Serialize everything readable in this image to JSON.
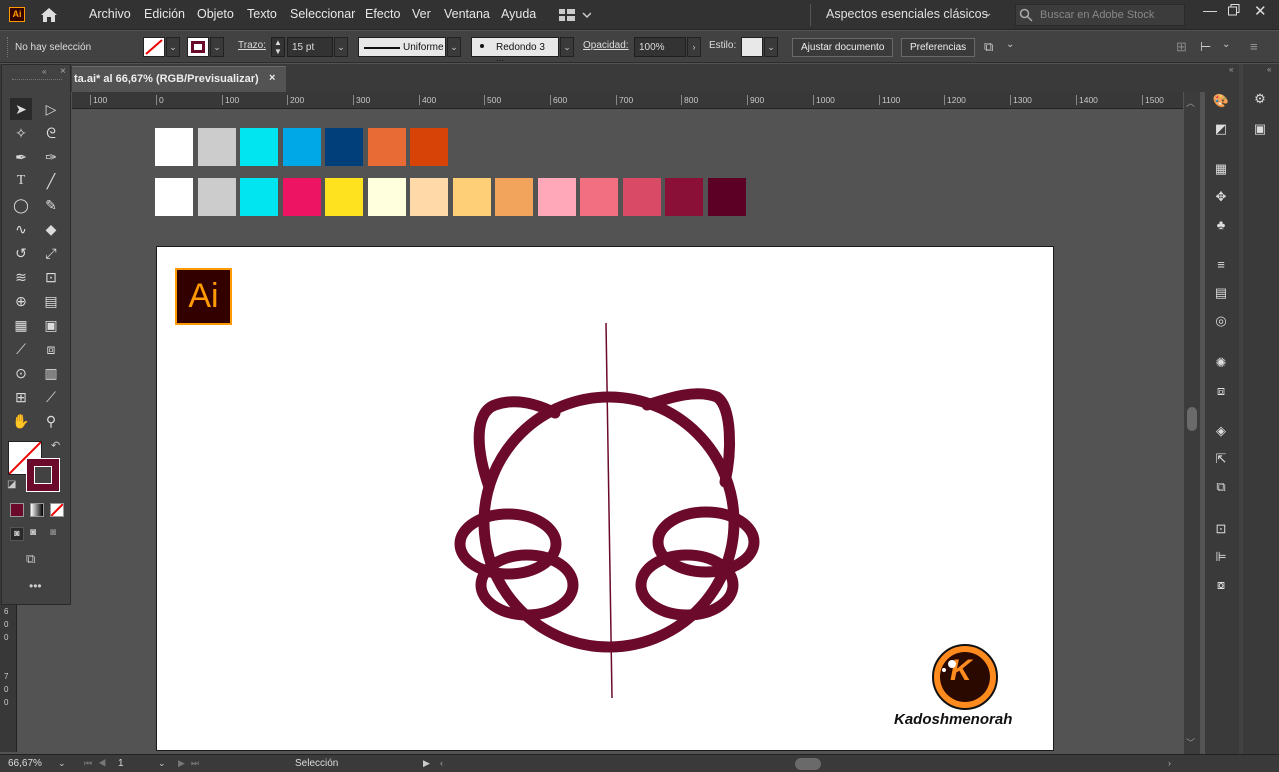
{
  "menubar": {
    "app_logo": "Ai",
    "items": [
      "Archivo",
      "Edición",
      "Objeto",
      "Texto",
      "Seleccionar",
      "Efecto",
      "Ver",
      "Ventana",
      "Ayuda"
    ],
    "workspace": "Aspectos esenciales clásicos",
    "stock_placeholder": "Buscar en Adobe Stock"
  },
  "control": {
    "selection": "No hay selección",
    "stroke_label": "Trazo:",
    "stroke_weight": "15 pt",
    "profile": "Uniforme",
    "brush": "Redondo 3 ...",
    "opacity_label": "Opacidad:",
    "opacity": "100%",
    "style_label": "Estilo:",
    "adjust_btn": "Ajustar documento",
    "prefs_btn": "Preferencias"
  },
  "document": {
    "tab_title": "ta.ai* al 66,67% (RGB/Previsualizar)",
    "close": "×"
  },
  "ruler": {
    "h_ticks": [
      "100",
      "0",
      "100",
      "200",
      "300",
      "400",
      "500",
      "600",
      "700",
      "800",
      "900",
      "1000",
      "1100",
      "1200",
      "1300",
      "1400",
      "1500"
    ],
    "v_ticks": [
      "6",
      "0",
      "0",
      "7",
      "0",
      "0"
    ]
  },
  "swatches": {
    "row1": [
      "#ffffff",
      "#cccccc",
      "#00e5f0",
      "#00a8e8",
      "#003f7a",
      "#e86a35",
      "#d74307"
    ],
    "row2": [
      "#ffffff",
      "#cccccc",
      "#00e5f0",
      "#ee1464",
      "#ffe21f",
      "#ffffdd",
      "#ffd9a8",
      "#ffcf78",
      "#f2a45c",
      "#ffa8b9",
      "#f26f82",
      "#d94a66",
      "#8a1038",
      "#5c0026"
    ]
  },
  "artwork": {
    "stroke_color": "#6b0a2b",
    "logo_text": "Ai",
    "brand_initial": "K",
    "brand_name": "Kadoshmenorah"
  },
  "status": {
    "zoom": "66,67%",
    "artboard_num": "1",
    "mode": "Selección"
  }
}
